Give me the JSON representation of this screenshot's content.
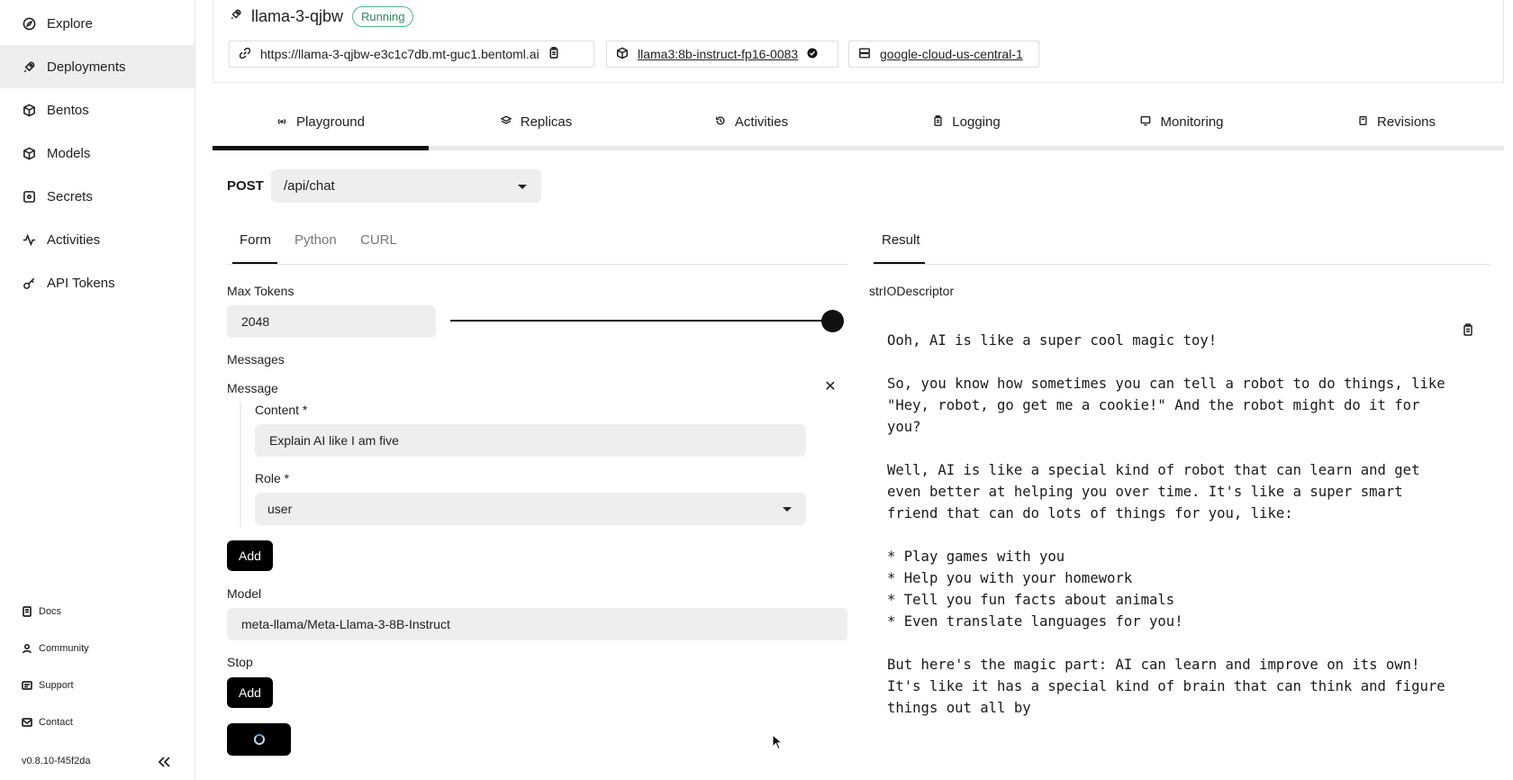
{
  "sidebar": {
    "items": [
      {
        "label": "Explore",
        "icon": "compass-icon"
      },
      {
        "label": "Deployments",
        "icon": "rocket-icon",
        "active": true
      },
      {
        "label": "Bentos",
        "icon": "box-icon"
      },
      {
        "label": "Models",
        "icon": "cube-icon"
      },
      {
        "label": "Secrets",
        "icon": "lock-box-icon"
      },
      {
        "label": "Activities",
        "icon": "pulse-icon"
      },
      {
        "label": "API Tokens",
        "icon": "key-icon"
      }
    ],
    "footer": [
      {
        "label": "Docs",
        "icon": "doc-icon"
      },
      {
        "label": "Community",
        "icon": "community-icon"
      },
      {
        "label": "Support",
        "icon": "support-icon"
      },
      {
        "label": "Contact",
        "icon": "contact-icon"
      }
    ],
    "version": "v0.8.10-f45f2da"
  },
  "deployment": {
    "name": "llama-3-qjbw",
    "status": "Running",
    "url": "https://llama-3-qjbw-e3c1c7db.mt-guc1.bentoml.ai",
    "bento": "llama3:8b-instruct-fp16-0083",
    "cluster": "google-cloud-us-central-1"
  },
  "tabs": [
    "Playground",
    "Replicas",
    "Activities",
    "Logging",
    "Monitoring",
    "Revisions"
  ],
  "request": {
    "method": "POST",
    "endpoint": "/api/chat",
    "subtabs": [
      "Form",
      "Python",
      "CURL"
    ],
    "max_tokens_label": "Max Tokens",
    "max_tokens_value": "2048",
    "max_tokens_slider_fraction": 1.0,
    "messages_label": "Messages",
    "message_label": "Message",
    "content_label": "Content *",
    "content_value": "Explain AI like I am five",
    "role_label": "Role *",
    "role_value": "user",
    "add_label": "Add",
    "model_label": "Model",
    "model_value": "meta-llama/Meta-Llama-3-8B-Instruct",
    "stop_label": "Stop",
    "stop_add_label": "Add"
  },
  "result": {
    "tab": "Result",
    "descriptor": "strIODescriptor",
    "lines": [
      "Ooh, AI is like a super cool magic toy!",
      "",
      "So, you know how sometimes you can tell a robot to do things, like",
      "\"Hey, robot, go get me a cookie!\" And the robot might do it for",
      "you?",
      "",
      "Well, AI is like a special kind of robot that can learn and get",
      "even better at helping you over time. It's like a super smart",
      "friend that can do lots of things for you, like:",
      "",
      "* Play games with you",
      "* Help you with your homework",
      "* Tell you fun facts about animals",
      "* Even translate languages for you!",
      "",
      "But here's the magic part: AI can learn and improve on its own!",
      "It's like it has a special kind of brain that can think and figure",
      "things out all by"
    ]
  },
  "colors": {
    "accent": "#111111",
    "status_green": "#54b683",
    "field_bg": "#eeeeee",
    "active_nav_bg": "#eeeeee"
  }
}
